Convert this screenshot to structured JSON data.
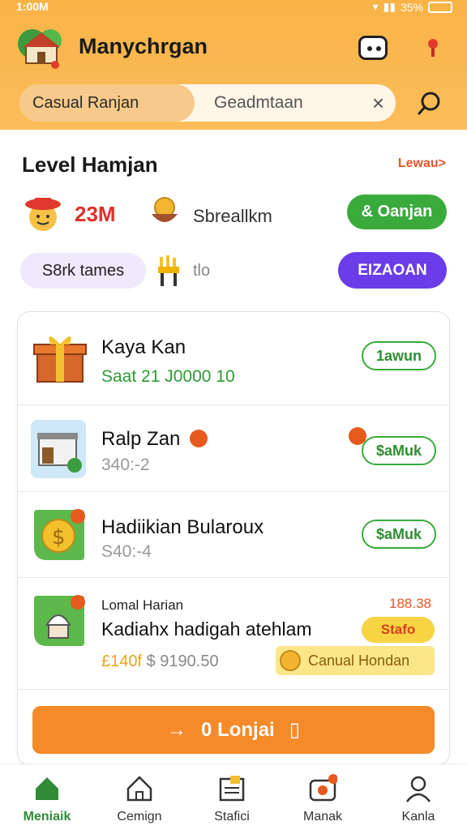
{
  "status_bar": {
    "time": "1:00M",
    "battery": "35%"
  },
  "header": {
    "app_title": "Manychrgan",
    "tabs": [
      {
        "label": "Casual Ranjan",
        "active": true
      },
      {
        "label": "Geadmtaan",
        "active": false
      }
    ],
    "icons": [
      "house-logo-icon",
      "chat-icon",
      "pin-icon",
      "close-icon",
      "search-icon"
    ]
  },
  "level": {
    "title": "Level Hamjan",
    "link": "Lewau>",
    "stat_value": "23M",
    "stat_label": "Sbreallkm",
    "green_button": "& Oanjan",
    "pill_label": "S8rk tames",
    "small_text": "tlo",
    "purple_button": "EIZAOAN"
  },
  "rows": [
    {
      "title": "Kaya Kan",
      "subtitle": "Saat 21 J0000 10",
      "button": "1awun",
      "icon": "gift-box-icon"
    },
    {
      "title": "Ralp Zan",
      "subtitle": "340:-2",
      "button": "$aMuk",
      "icon": "shop-icon"
    },
    {
      "title": "Hadiikian Bularoux",
      "subtitle": "S40:-4",
      "button": "$aMuk",
      "icon": "coin-icon"
    },
    {
      "label": "Lomal Harian",
      "title": "Kadiahx hadigah atehlam",
      "amount": "188.38",
      "price_prefix": "£140f",
      "price": "$ 9190.50",
      "pill_button": "Stafo",
      "pill_label": "Canual Hondan",
      "icon": "cupcake-icon"
    }
  ],
  "cta": {
    "label": "0 Lonjai",
    "arrow": "→",
    "suffix": "▯"
  },
  "bottom_nav": [
    {
      "label": "Meniaik",
      "icon": "home-icon",
      "active": true
    },
    {
      "label": "Cemign",
      "icon": "house-outline-icon",
      "active": false
    },
    {
      "label": "Stafici",
      "icon": "list-icon",
      "active": false
    },
    {
      "label": "Manak",
      "icon": "camera-icon",
      "active": false
    },
    {
      "label": "Kanla",
      "icon": "profile-icon",
      "active": false
    }
  ],
  "colors": {
    "header": "#f9b347",
    "green": "#3aaa3c",
    "purple": "#6a3de8",
    "orange_cta": "#f58a2a",
    "red_text": "#e02f2a"
  }
}
